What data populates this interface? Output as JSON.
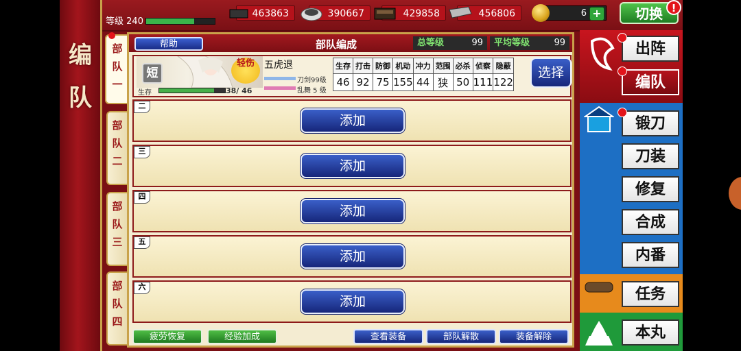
{
  "sidebar_title": [
    "编",
    "队"
  ],
  "status": {
    "level_label": "等级",
    "level": "240"
  },
  "resources": [
    {
      "name": "charcoal",
      "value": "463863"
    },
    {
      "name": "steel",
      "value": "390667"
    },
    {
      "name": "coolant",
      "value": "429858"
    },
    {
      "name": "whetstone",
      "value": "456806"
    }
  ],
  "koban": {
    "value": "6",
    "plus": "+"
  },
  "switch_button": "切换",
  "switch_alert": "!",
  "party_tabs": [
    "部队一",
    "部队二",
    "部队三",
    "部队四"
  ],
  "panel": {
    "help": "帮助",
    "title": "部队编成",
    "total_level_label": "总等级",
    "total_level": "99",
    "avg_level_label": "平均等级",
    "avg_level": "99"
  },
  "sword": {
    "type_badge": "短",
    "injury": "轻伤",
    "name": "五虎退",
    "hp_label": "生存",
    "hp": "38/ 46",
    "hp_fraction": 0.83,
    "level_text": "刀剑99级",
    "ranbu_text": "乱舞 5 级",
    "stat_headers": [
      "生存",
      "打击",
      "防御",
      "机动",
      "冲力",
      "范围",
      "必杀",
      "侦察",
      "隐蔽"
    ],
    "stat_values": [
      "46",
      "92",
      "75",
      "155",
      "44",
      "狭",
      "50",
      "111",
      "122"
    ],
    "select": "选择"
  },
  "slots": [
    {
      "num": "二",
      "add": "添加"
    },
    {
      "num": "三",
      "add": "添加"
    },
    {
      "num": "四",
      "add": "添加"
    },
    {
      "num": "五",
      "add": "添加"
    },
    {
      "num": "六",
      "add": "添加"
    }
  ],
  "bottom_buttons": {
    "fatigue": "疲劳恢复",
    "exp": "经验加成",
    "equip_view": "查看装备",
    "disband": "部队解散",
    "unequip": "装备解除"
  },
  "right_menu": [
    "出阵",
    "编队",
    "锻刀",
    "刀装",
    "修复",
    "合成",
    "内番",
    "任务",
    "本丸"
  ],
  "colors": {
    "accent_red": "#b5121b",
    "button_blue": "#1a2c86",
    "button_green": "#2fa53a"
  }
}
